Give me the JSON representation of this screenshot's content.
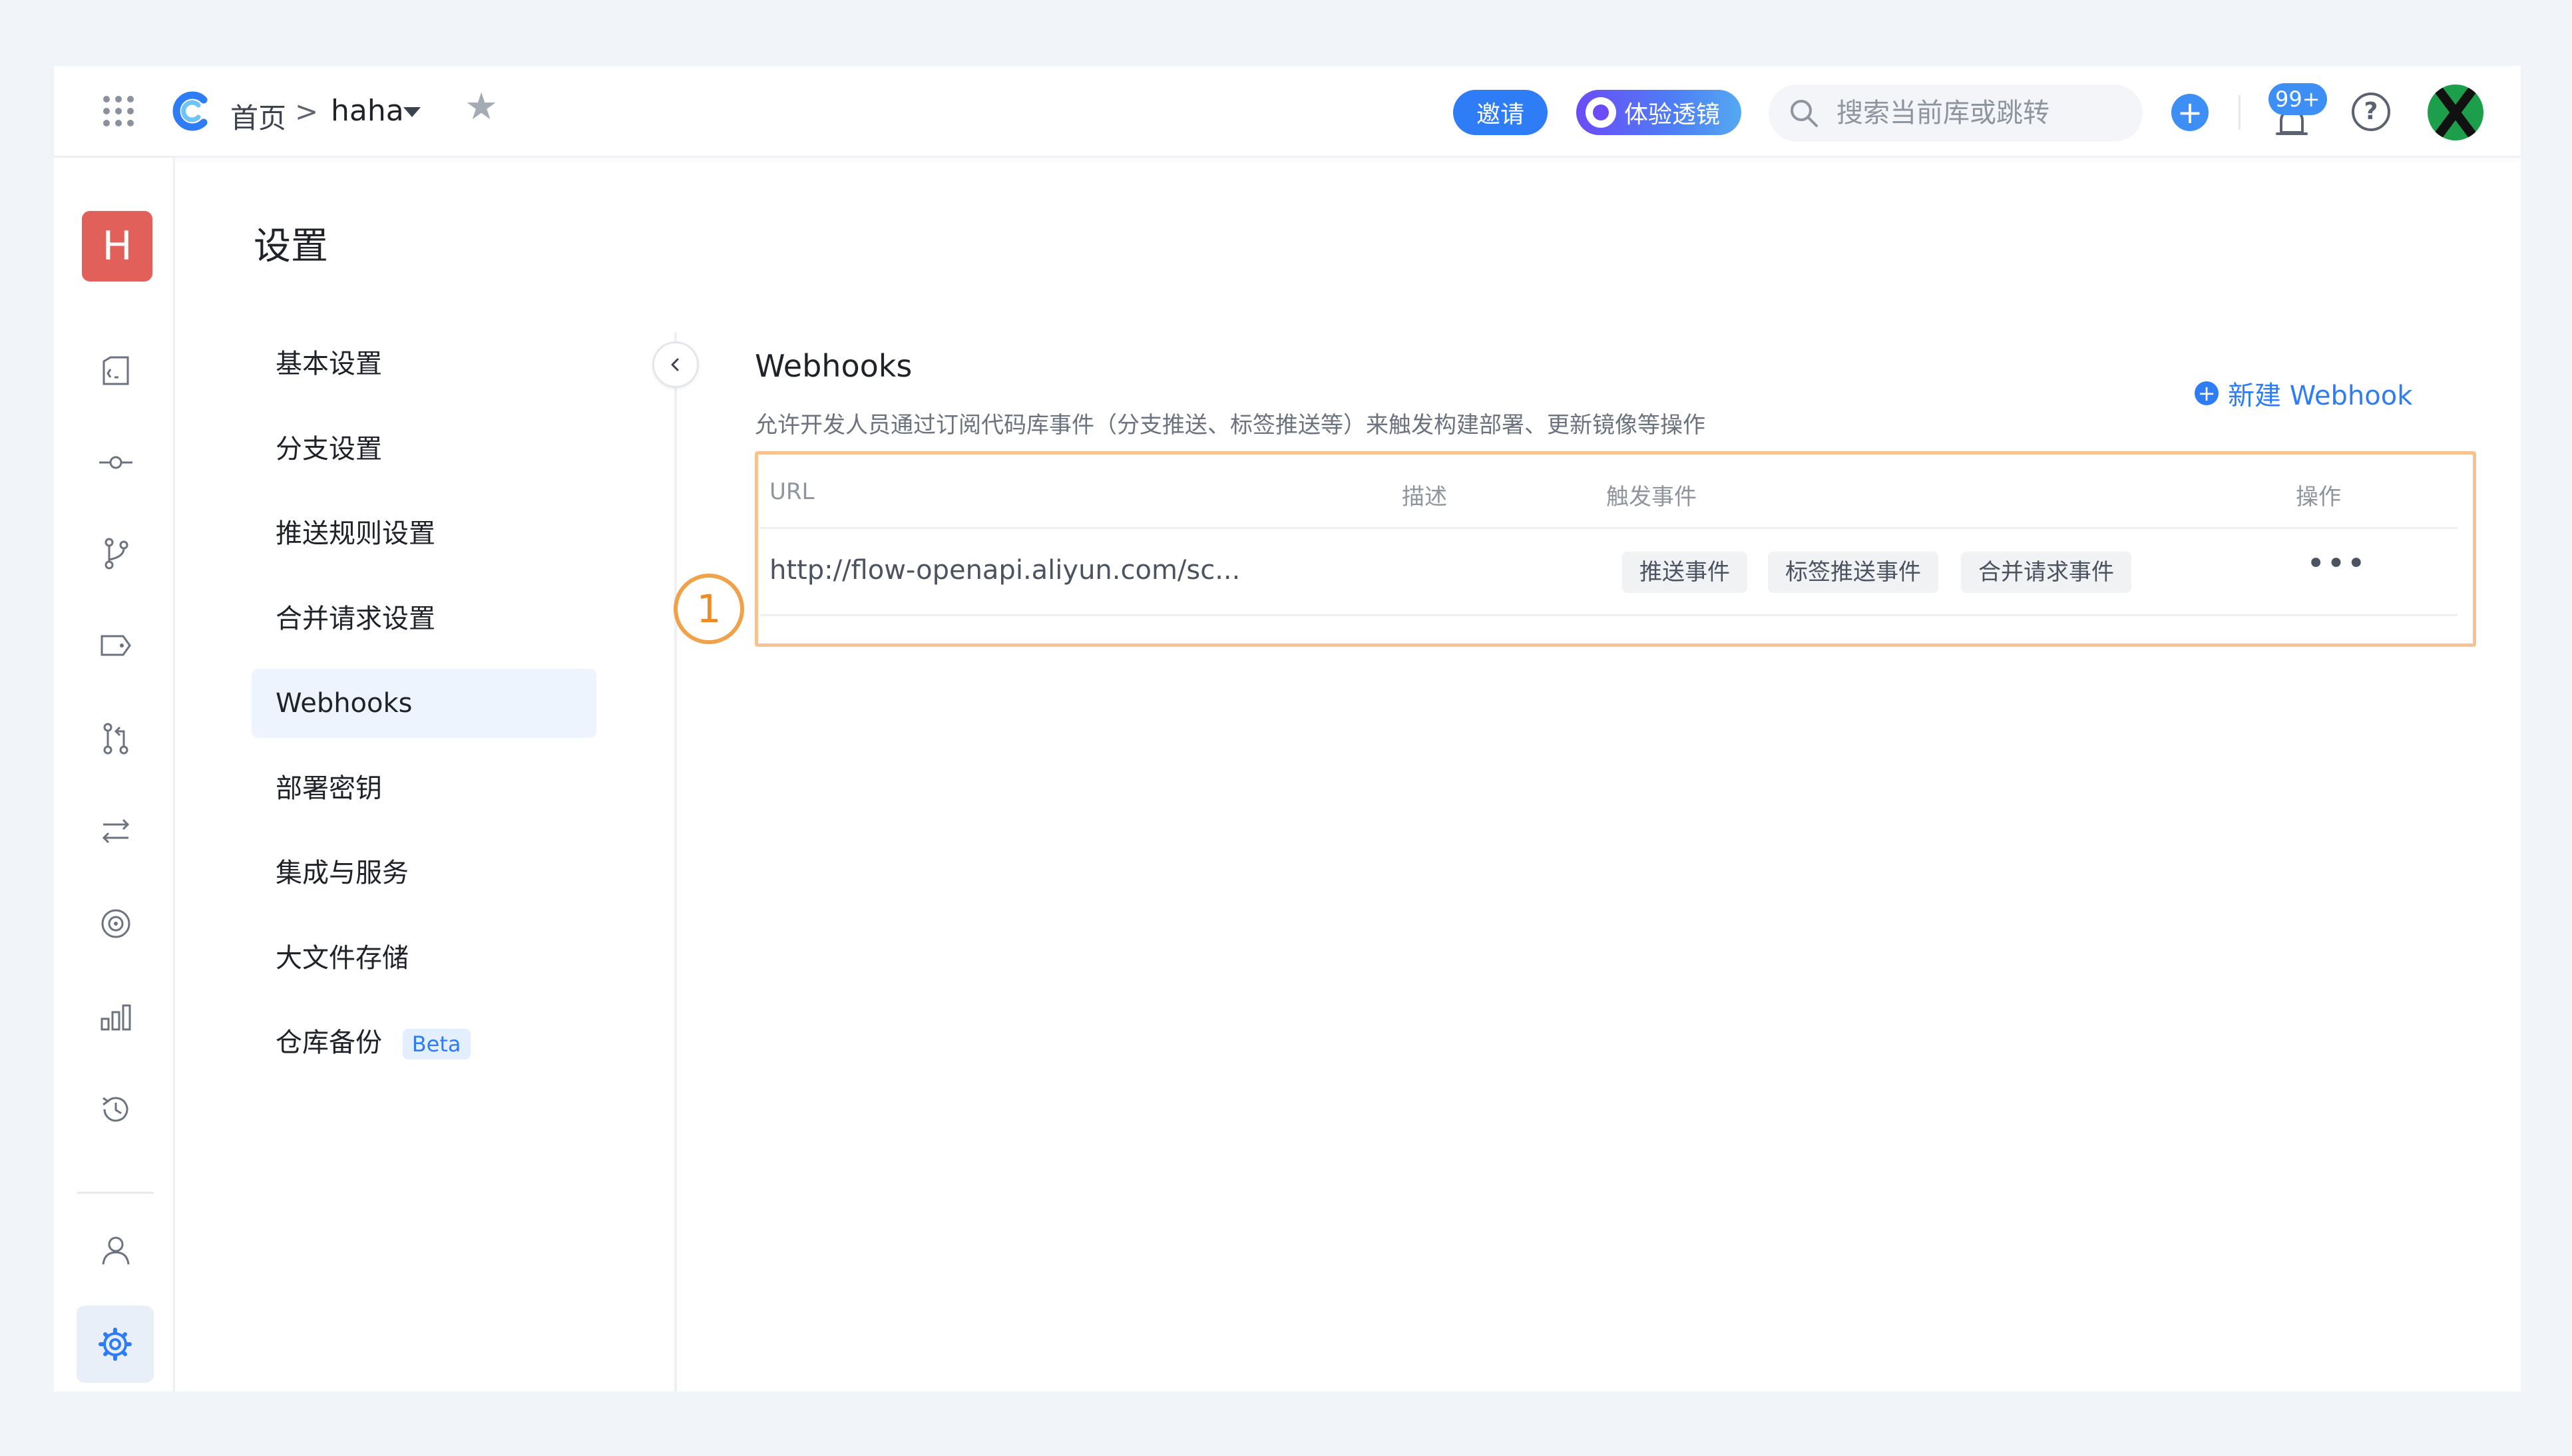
{
  "topbar": {
    "crumb_home": "首页",
    "crumb_sep": ">",
    "repo_name": "haha",
    "invite_label": "邀请",
    "lens_label": "体验透镜",
    "search_placeholder": "搜索当前库或跳转",
    "plus_label": "+",
    "notification_count": "99+",
    "help_label": "?",
    "avatar_label": "X"
  },
  "rail": {
    "repo_avatar_letter": "H",
    "icons": [
      "code-icon",
      "commit-icon",
      "branch-icon",
      "tag-icon",
      "merge-request-icon",
      "pipeline-icon",
      "security-icon",
      "chart-icon",
      "history-icon",
      "member-icon",
      "settings-icon"
    ]
  },
  "settings": {
    "title": "设置",
    "nav": [
      {
        "label": "基本设置"
      },
      {
        "label": "分支设置"
      },
      {
        "label": "推送规则设置"
      },
      {
        "label": "合并请求设置"
      },
      {
        "label": "Webhooks",
        "active": true
      },
      {
        "label": "部署密钥"
      },
      {
        "label": "集成与服务"
      },
      {
        "label": "大文件存储"
      },
      {
        "label": "仓库备份",
        "badge": "Beta"
      }
    ]
  },
  "webhooks": {
    "title": "Webhooks",
    "description": "允许开发人员通过订阅代码库事件（分支推送、标签推送等）来触发构建部署、更新镜像等操作",
    "new_button": "新建 Webhook",
    "columns": [
      "URL",
      "描述",
      "触发事件",
      "操作"
    ],
    "rows": [
      {
        "url": "http://flow-openapi.aliyun.com/sc...",
        "description": "",
        "events": [
          "推送事件",
          "标签推送事件",
          "合并请求事件"
        ],
        "action": "•••"
      }
    ]
  },
  "annotation": {
    "step": "1"
  },
  "colors": {
    "accent": "#2e7cf6",
    "repo_avatar": "#e2605a",
    "highlight_border": "#f6c28f",
    "step_marker": "#f08a24"
  }
}
